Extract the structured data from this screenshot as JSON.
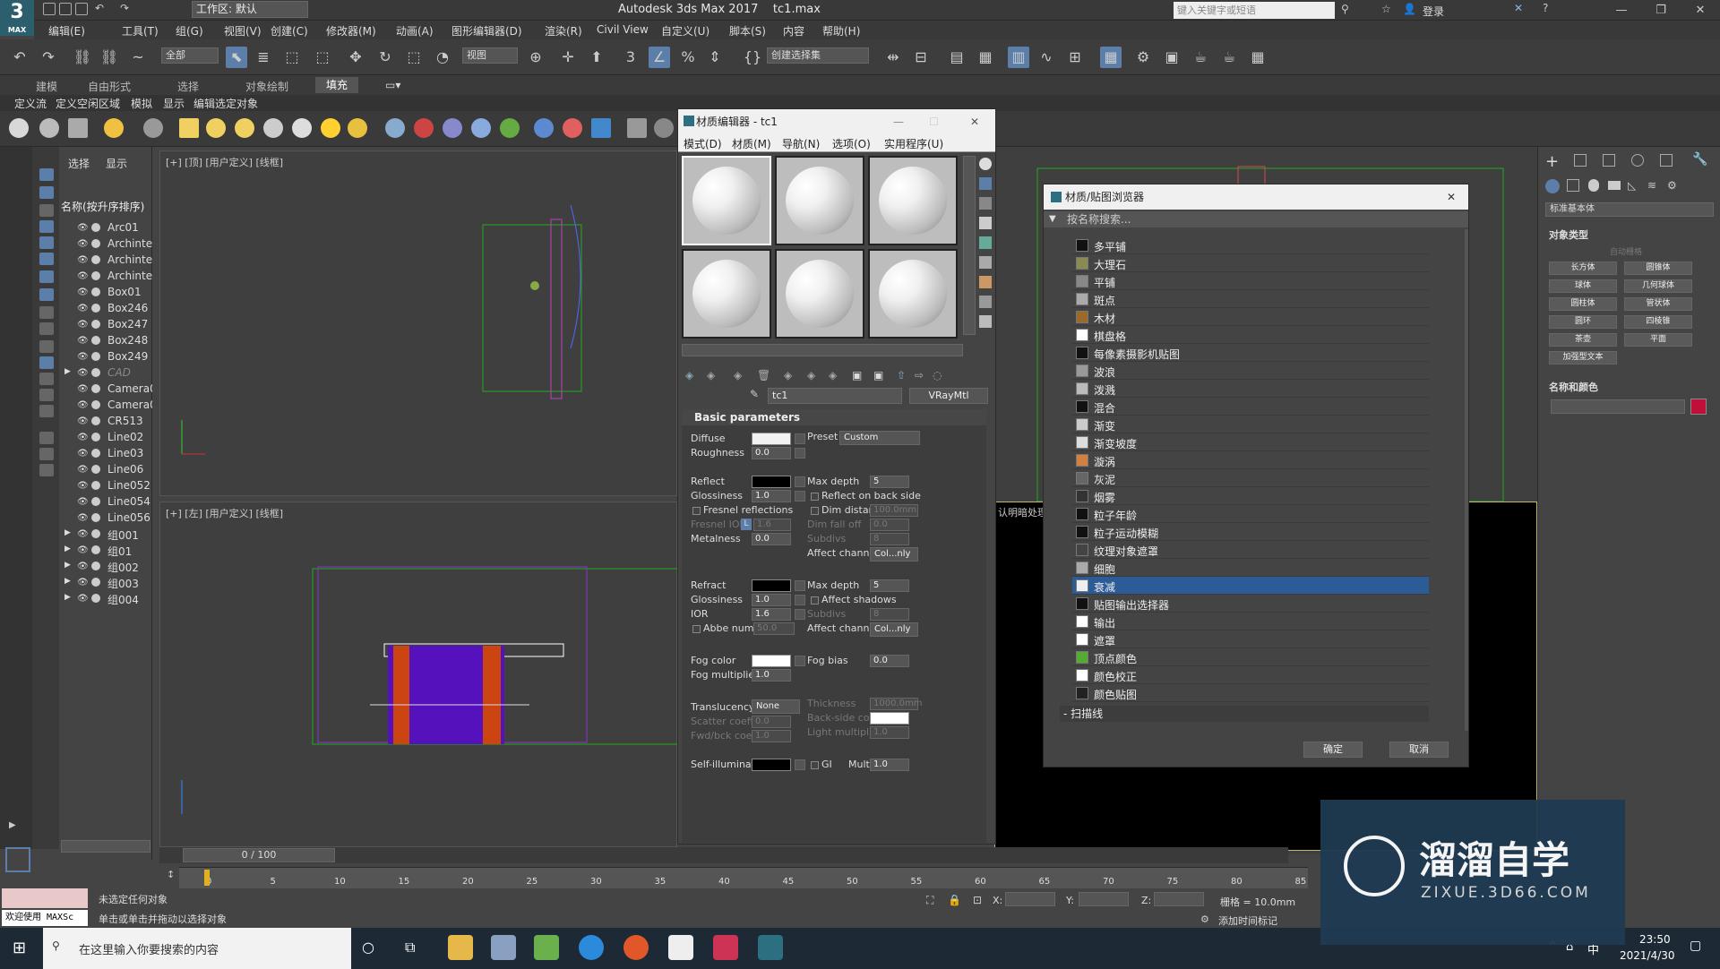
{
  "app": {
    "title": "Autodesk 3ds Max 2017",
    "file": "tc1.max",
    "logo": "MAX",
    "workspace": "工作区: 默认",
    "search_placeholder": "键入关键字或短语",
    "login": "登录"
  },
  "menu": [
    "编辑(E)",
    "工具(T)",
    "组(G)",
    "视图(V)",
    "创建(C)",
    "修改器(M)",
    "动画(A)",
    "图形编辑器(D)",
    "渲染(R)",
    "Civil View",
    "自定义(U)",
    "脚本(S)",
    "内容",
    "帮助(H)"
  ],
  "toolbar": {
    "filter": "全部",
    "refcoord": "视图",
    "selset": "创建选择集"
  },
  "ribbon": {
    "tabs": [
      "建模",
      "自由形式",
      "选择",
      "对象绘制",
      "填充"
    ],
    "active": "填充",
    "sub": [
      "定义流",
      "定义空闲区域",
      "模拟",
      "显示",
      "编辑选定对象"
    ]
  },
  "scene": {
    "tabs": [
      "选择",
      "显示"
    ],
    "header": "名称(按升序排序)",
    "items": [
      {
        "name": "Arc01",
        "exp": false
      },
      {
        "name": "Archinter",
        "exp": false
      },
      {
        "name": "Archinter",
        "exp": false
      },
      {
        "name": "Archinter",
        "exp": false
      },
      {
        "name": "Box01",
        "exp": false
      },
      {
        "name": "Box246",
        "exp": false
      },
      {
        "name": "Box247",
        "exp": false
      },
      {
        "name": "Box248",
        "exp": false
      },
      {
        "name": "Box249",
        "exp": false
      },
      {
        "name": "CAD",
        "exp": true
      },
      {
        "name": "Camera0",
        "exp": false
      },
      {
        "name": "Camera0",
        "exp": false
      },
      {
        "name": "CR513",
        "exp": false
      },
      {
        "name": "Line02",
        "exp": false
      },
      {
        "name": "Line03",
        "exp": false
      },
      {
        "name": "Line06",
        "exp": false
      },
      {
        "name": "Line052",
        "exp": false
      },
      {
        "name": "Line054",
        "exp": false
      },
      {
        "name": "Line056",
        "exp": false
      },
      {
        "name": "组001",
        "exp": true
      },
      {
        "name": "组01",
        "exp": true
      },
      {
        "name": "组002",
        "exp": true
      },
      {
        "name": "组003",
        "exp": true
      },
      {
        "name": "组004",
        "exp": true
      }
    ]
  },
  "viewports": {
    "top": "[+] [顶] [用户定义] [线框]",
    "left": "[+] [左] [用户定义] [线框]",
    "camera_fragment": "认明暗处理"
  },
  "mated": {
    "title": "材质编辑器 - tc1",
    "menu": [
      "模式(D)",
      "材质(M)",
      "导航(N)",
      "选项(O)",
      "实用程序(U)"
    ],
    "material": "tc1",
    "type": "VRayMtl",
    "rollout": "Basic parameters",
    "diffuse": "Diffuse",
    "preset_label": "Preset",
    "preset": "Custom",
    "roughness": "Roughness",
    "roughness_v": "0.0",
    "reflect": "Reflect",
    "maxdepth": "Max depth",
    "maxdepth_v": "5",
    "glossiness": "Glossiness",
    "gloss_v": "1.0",
    "reflect_back": "Reflect on back side",
    "fresnel": "Fresnel reflections",
    "dimdist": "Dim distance",
    "dimdist_v": "100.0mm",
    "fresnel_ior": "Fresnel IOR",
    "fresnel_l": "L",
    "fresnel_ior_v": "1.6",
    "dimfall": "Dim fall off",
    "dimfall_v": "0.0",
    "metalness": "Metalness",
    "metal_v": "0.0",
    "subdivs": "Subdivs",
    "subdivs_v": "8",
    "affect_ch": "Affect channels",
    "affect_v": "Col...nly",
    "refract": "Refract",
    "maxdepth2_v": "5",
    "gloss2_v": "1.0",
    "affect_shadows": "Affect shadows",
    "ior": "IOR",
    "ior_v": "1.6",
    "subdivs2_v": "8",
    "abbe": "Abbe number",
    "abbe_v": "50.0",
    "affect2_v": "Col...nly",
    "fog": "Fog color",
    "fogbias": "Fog bias",
    "fogbias_v": "0.0",
    "fogmult": "Fog multiplier",
    "fogmult_v": "1.0",
    "translucency": "Translucency",
    "transl_v": "None",
    "thickness": "Thickness",
    "thickness_v": "1000.0mm",
    "scatter": "Scatter coeff",
    "scatter_v": "0.0",
    "backside": "Back-side color",
    "fwdbck": "Fwd/bck coeff",
    "fwdbck_v": "1.0",
    "lightmult": "Light multiplier",
    "lightmult_v": "1.0",
    "selfillum": "Self-illumination",
    "gi": "GI",
    "mult": "Mult",
    "mult_v": "1.0"
  },
  "browser": {
    "title": "材质/贴图浏览器",
    "search": "按名称搜索...",
    "ok": "确定",
    "cancel": "取消",
    "group": "- 扫描线",
    "items": [
      {
        "n": "多平铺",
        "c": "#111111"
      },
      {
        "n": "大理石",
        "c": "#8a8a55"
      },
      {
        "n": "平铺",
        "c": "#888888"
      },
      {
        "n": "斑点",
        "c": "#aaaaaa"
      },
      {
        "n": "木材",
        "c": "#9b6a2a"
      },
      {
        "n": "棋盘格",
        "c": "#ffffff"
      },
      {
        "n": "每像素摄影机贴图",
        "c": "#111111"
      },
      {
        "n": "波浪",
        "c": "#999999"
      },
      {
        "n": "泼溅",
        "c": "#bbbbbb"
      },
      {
        "n": "混合",
        "c": "#111111"
      },
      {
        "n": "渐变",
        "c": "#cccccc"
      },
      {
        "n": "渐变坡度",
        "c": "#dddddd"
      },
      {
        "n": "漩涡",
        "c": "#d08040"
      },
      {
        "n": "灰泥",
        "c": "#666666"
      },
      {
        "n": "烟雾",
        "c": "#333333"
      },
      {
        "n": "粒子年龄",
        "c": "#111111"
      },
      {
        "n": "粒子运动模糊",
        "c": "#111111"
      },
      {
        "n": "纹理对象遮罩",
        "c": "#444444"
      },
      {
        "n": "细胞",
        "c": "#aaaaaa"
      },
      {
        "n": "衰减",
        "c": "#eeeeee",
        "sel": true
      },
      {
        "n": "贴图输出选择器",
        "c": "#111111"
      },
      {
        "n": "输出",
        "c": "#ffffff"
      },
      {
        "n": "遮罩",
        "c": "#ffffff"
      },
      {
        "n": "顶点颜色",
        "c": "#55aa33"
      },
      {
        "n": "颜色校正",
        "c": "#ffffff"
      },
      {
        "n": "颜色贴图",
        "c": "#222222"
      }
    ]
  },
  "cmd": {
    "dropdown": "标准基本体",
    "objtype": "对象类型",
    "autogrid": "自动栅格",
    "buttons": [
      "长方体",
      "圆锥体",
      "球体",
      "几何球体",
      "圆柱体",
      "管状体",
      "圆环",
      "四棱锥",
      "茶壶",
      "平面",
      "加强型文本"
    ],
    "namecolor": "名称和颜色",
    "color": "#c0103a"
  },
  "time": {
    "frame": "0 / 100",
    "ticks": [
      "0",
      "5",
      "10",
      "15",
      "20",
      "25",
      "30",
      "35",
      "40",
      "45",
      "50",
      "55",
      "60",
      "65",
      "70",
      "75",
      "80",
      "85"
    ]
  },
  "status": {
    "msg1": "未选定任何对象",
    "msg2": "单击或单击并拖动以选择对象",
    "welcome": "欢迎使用 MAXSc",
    "x": "X:",
    "y": "Y:",
    "z": "Z:",
    "grid": "栅格 = 10.0mm",
    "addtime": "添加时间标记"
  },
  "taskbar": {
    "search": "在这里输入你要搜索的内容",
    "time": "23:50",
    "date": "2021/4/30",
    "ime": "中"
  },
  "watermark": {
    "brand": "溜溜自学",
    "url": "ZIXUE.3D66.COM"
  }
}
